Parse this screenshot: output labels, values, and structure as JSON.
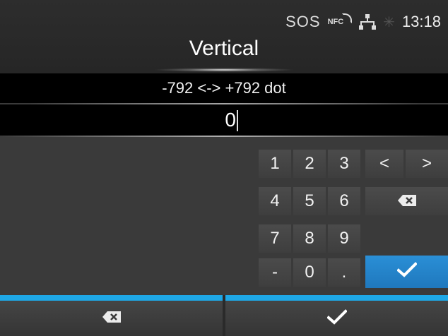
{
  "status": {
    "sos": "SOS",
    "nfc": "NFC",
    "lan_icon": "lan-icon",
    "bluetooth_icon": "bluetooth-icon",
    "time": "13:18"
  },
  "header": {
    "title": "Vertical"
  },
  "range": {
    "text": "-792 <-> +792 dot"
  },
  "input": {
    "value": "0"
  },
  "keypad": {
    "keys": {
      "k1": "1",
      "k2": "2",
      "k3": "3",
      "k4": "4",
      "k5": "5",
      "k6": "6",
      "k7": "7",
      "k8": "8",
      "k9": "9",
      "minus": "-",
      "k0": "0",
      "dot": ".",
      "left": "<",
      "right": ">"
    },
    "icons": {
      "backspace": "backspace-icon",
      "enter": "check-icon"
    }
  },
  "colors": {
    "accent": "#1ea7e6",
    "enter_key": "#2185cc",
    "background": "#3a3a3a"
  }
}
